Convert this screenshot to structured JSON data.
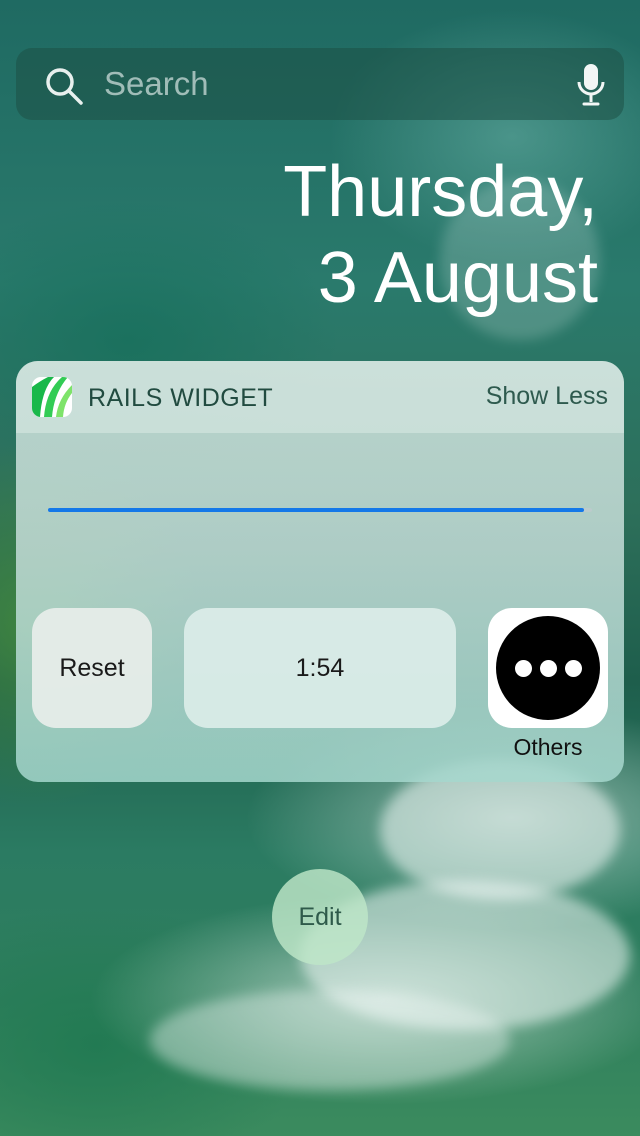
{
  "search": {
    "placeholder": "Search",
    "icon": "search-icon",
    "mic_icon": "microphone-icon"
  },
  "date": {
    "line1": "Thursday,",
    "line2": "3 August"
  },
  "widget": {
    "app_icon": "rails-app-icon",
    "title": "RAILS WIDGET",
    "show_less_label": "Show Less",
    "progress_fraction": 0.985,
    "progress_color": "#1478e8",
    "buttons": {
      "reset_label": "Reset",
      "time_label": "1:54",
      "others_label": "Others",
      "others_icon": "more-dots-icon"
    }
  },
  "edit_label": "Edit"
}
